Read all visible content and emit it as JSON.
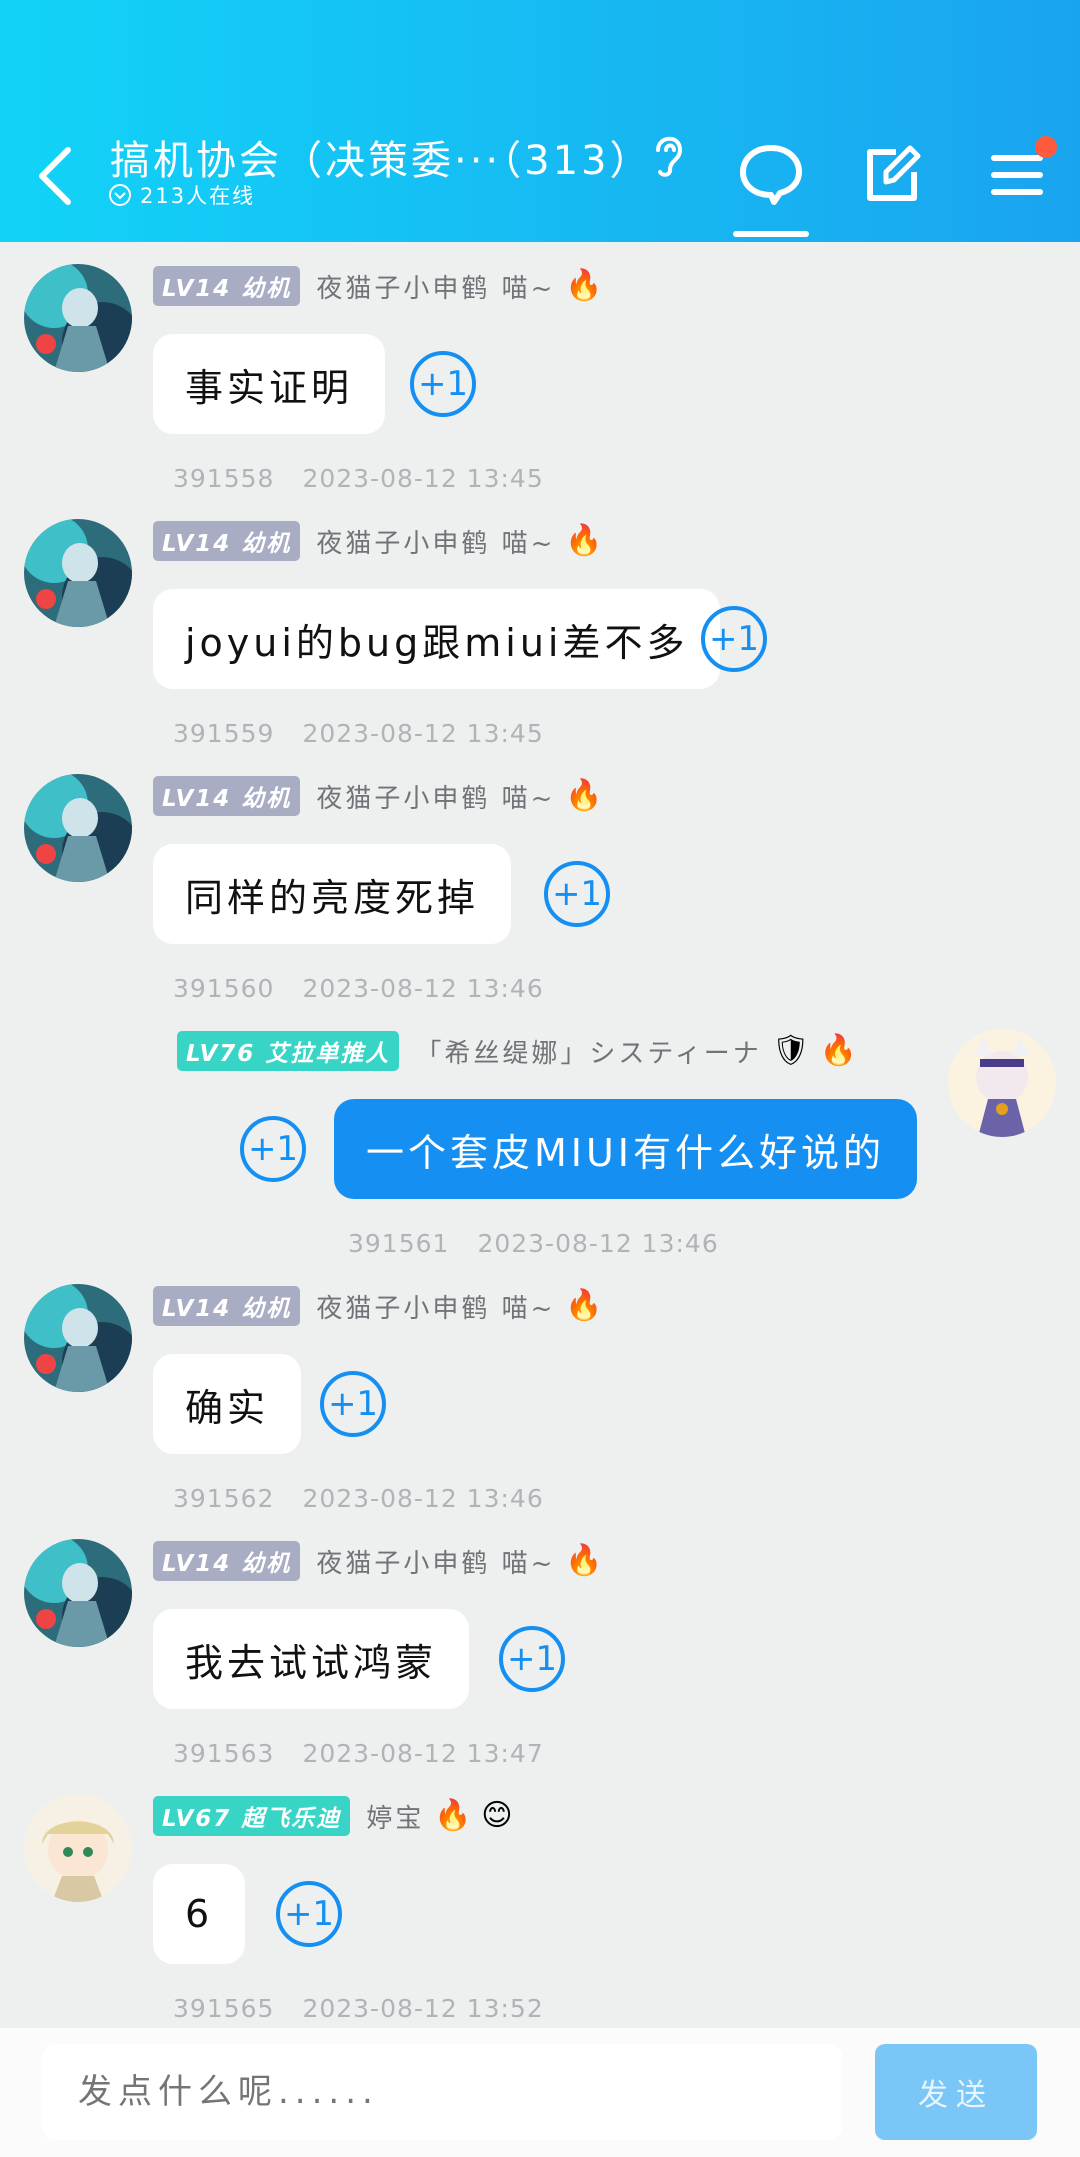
{
  "header": {
    "title": "搞机协会（决策委···（313）",
    "online": "213人在线"
  },
  "input": {
    "placeholder": "发点什么呢......",
    "send_label": "发送"
  },
  "plus_one": "+1",
  "messages": [
    {
      "level": "LV14 幼机",
      "user": "夜猫子小申鹤 喵~",
      "badges": "🔥",
      "text": "事实证明",
      "id": "391558",
      "time": "2023-08-12 13:45"
    },
    {
      "level": "LV14 幼机",
      "user": "夜猫子小申鹤 喵~",
      "badges": "🔥",
      "text": "joyui的bug跟miui差不多",
      "id": "391559",
      "time": "2023-08-12 13:45"
    },
    {
      "level": "LV14 幼机",
      "user": "夜猫子小申鹤 喵~",
      "badges": "🔥",
      "text": "同样的亮度死掉",
      "id": "391560",
      "time": "2023-08-12 13:46"
    },
    {
      "level": "LV76 艾拉单推人",
      "user": "「希丝缇娜」システィーナ",
      "badges": "🔥",
      "text": "一个套皮MIUI有什么好说的",
      "id": "391561",
      "time": "2023-08-12 13:46"
    },
    {
      "level": "LV14 幼机",
      "user": "夜猫子小申鹤 喵~",
      "badges": "🔥",
      "text": "确实",
      "id": "391562",
      "time": "2023-08-12 13:46"
    },
    {
      "level": "LV14 幼机",
      "user": "夜猫子小申鹤 喵~",
      "badges": "🔥",
      "text": "我去试试鸿蒙",
      "id": "391563",
      "time": "2023-08-12 13:47"
    },
    {
      "level": "LV67 超飞乐迪",
      "user": "婷宝",
      "badges": "🔥 😊",
      "text": "6",
      "id": "391565",
      "time": "2023-08-12 13:52"
    }
  ],
  "colors": {
    "accent": "#1590f2",
    "header_start": "#12d3f7",
    "header_end": "#1aa4ef"
  }
}
